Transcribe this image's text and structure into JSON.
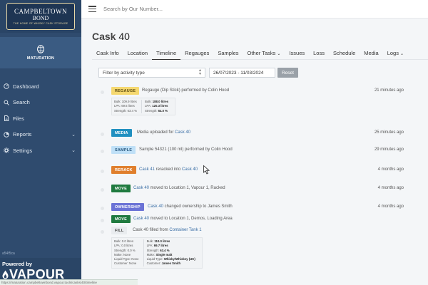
{
  "brand": {
    "line1": "CAMPBELTOWN",
    "line2": "BOND",
    "tagline": "THE HOME OF WHISKY CASK STORAGE"
  },
  "module": {
    "label": "MATURATION",
    "icon": "cask-icon"
  },
  "sidebar": {
    "items": [
      {
        "label": "Dashboard",
        "icon": "gauge-icon",
        "has_submenu": false
      },
      {
        "label": "Search",
        "icon": "search-icon",
        "has_submenu": false
      },
      {
        "label": "Files",
        "icon": "file-icon",
        "has_submenu": false
      },
      {
        "label": "Reports",
        "icon": "chart-icon",
        "has_submenu": true
      },
      {
        "label": "Settings",
        "icon": "gear-icon",
        "has_submenu": true
      }
    ],
    "version": "a54f5ca",
    "powered_by": "Powered by",
    "vapour": "VAPOUR"
  },
  "topbar": {
    "search_placeholder": "Search by Our Number..."
  },
  "page": {
    "title_prefix": "Cask",
    "title_number": "40"
  },
  "tabs": [
    {
      "label": "Cask Info",
      "active": false,
      "dropdown": false
    },
    {
      "label": "Location",
      "active": false,
      "dropdown": false
    },
    {
      "label": "Timeline",
      "active": true,
      "dropdown": false
    },
    {
      "label": "Regauges",
      "active": false,
      "dropdown": false
    },
    {
      "label": "Samples",
      "active": false,
      "dropdown": false
    },
    {
      "label": "Other Tasks",
      "active": false,
      "dropdown": true
    },
    {
      "label": "Issues",
      "active": false,
      "dropdown": false
    },
    {
      "label": "Loss",
      "active": false,
      "dropdown": false
    },
    {
      "label": "Schedule",
      "active": false,
      "dropdown": false
    },
    {
      "label": "Media",
      "active": false,
      "dropdown": false
    },
    {
      "label": "Logs",
      "active": false,
      "dropdown": true
    }
  ],
  "filters": {
    "activity_placeholder": "Filter by activity type",
    "date_range": "26/07/2023 - 11/03/2024",
    "reset_label": "Reset"
  },
  "colors": {
    "regauge": "#f5d870",
    "media": "#2190c0",
    "sample": "#bfe0f7",
    "rerack": "#e07f2d",
    "move": "#1f7a3f",
    "ownership": "#6b73d6",
    "fill": "#e9ecef"
  },
  "timeline": [
    {
      "badge": "REGAUGE",
      "type": "regauge",
      "parts": [
        {
          "t": "Regauge (Dip Stick) performed by Colin Hood",
          "link": false
        }
      ],
      "time": "21 minutes ago",
      "stats": {
        "left": [
          "Bulk: 109.9 litres",
          "LPA: 69.6 litres",
          "Strength: 63.4 %"
        ],
        "right": [
          [
            "Bulk:",
            "188.0 litres"
          ],
          [
            "LPA:",
            "120.3 litres"
          ],
          [
            "Strength:",
            "64.0 %"
          ]
        ]
      }
    },
    {
      "badge": "MEDIA",
      "type": "media",
      "parts": [
        {
          "t": "Media uploaded for ",
          "link": false
        },
        {
          "t": "Cask 40",
          "link": true
        }
      ],
      "time": "25 minutes ago"
    },
    {
      "badge": "SAMPLE",
      "type": "sample",
      "parts": [
        {
          "t": "Sample 54321 (100 ml) performed by Colin Hood",
          "link": false
        }
      ],
      "time": "29 minutes ago"
    },
    {
      "badge": "RERACK",
      "type": "rerack",
      "parts": [
        {
          "t": "Cask 41",
          "link": true
        },
        {
          "t": " reracked into ",
          "link": false
        },
        {
          "t": "Cask 40",
          "link": true
        }
      ],
      "time": "4 months ago"
    },
    {
      "badge": "MOVE",
      "type": "move",
      "parts": [
        {
          "t": "Cask 40",
          "link": true
        },
        {
          "t": " moved to Location 1, Vapour 1, Racked",
          "link": false
        }
      ],
      "time": "4 months ago"
    },
    {
      "badge": "OWNERSHIP",
      "type": "ownership",
      "parts": [
        {
          "t": "Cask 40",
          "link": true
        },
        {
          "t": " changed ownership to James Smith",
          "link": false
        }
      ],
      "time": "4 months ago"
    },
    {
      "badge": "MOVE",
      "type": "move",
      "parts": [
        {
          "t": "Cask 40",
          "link": true
        },
        {
          "t": " moved to Location 1, Demos, Loading Area",
          "link": false
        }
      ],
      "time": ""
    },
    {
      "badge": "FILL",
      "type": "fill",
      "parts": [
        {
          "t": "Cask 40 filled from ",
          "link": false
        },
        {
          "t": "Container Tank 1",
          "link": true
        }
      ],
      "time": "",
      "stats": {
        "left": [
          "Bulk: 0.0 litres",
          "LPA: 0.0 litres",
          "Strength: 0.0 %",
          "Make: None",
          "Liquid Type: None",
          "Customer: None"
        ],
        "right": [
          [
            "Bulk:",
            "110.0 litres"
          ],
          [
            "LPA:",
            "69.7 litres"
          ],
          [
            "Strength:",
            "63.4 %"
          ],
          [
            "Make:",
            "Single malt"
          ],
          [
            "Liquid Type:",
            "Whisky/Whiskey (UK)"
          ],
          [
            "Customer:",
            "James Smith"
          ]
        ]
      }
    }
  ],
  "statusbar": "https://maturation.campbeltownbond.vapour.tools/casks/40/timeline"
}
